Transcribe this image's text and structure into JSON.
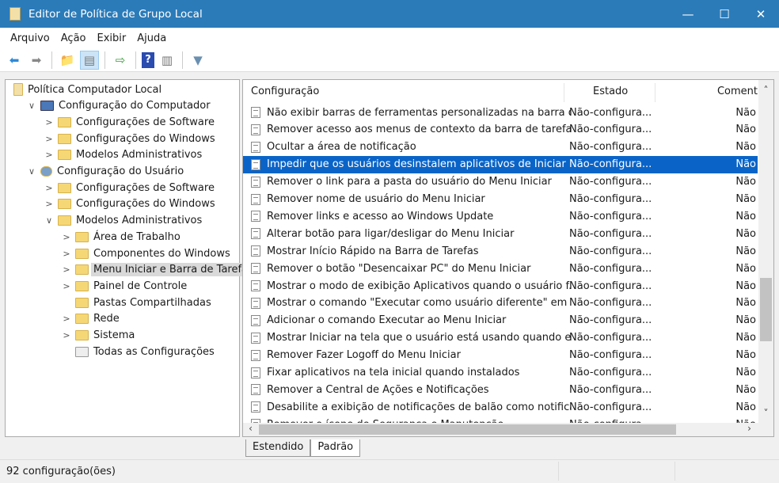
{
  "window": {
    "title": "Editor de Política de Grupo Local",
    "minimize": "—",
    "maximize": "☐",
    "close": "✕"
  },
  "menu": [
    "Arquivo",
    "Ação",
    "Exibir",
    "Ajuda"
  ],
  "tree": [
    {
      "label": "Política Computador Local",
      "level": 0,
      "expander": "",
      "icon": "policy"
    },
    {
      "label": "Configuração do Computador",
      "level": 1,
      "expander": "∨",
      "icon": "computer"
    },
    {
      "label": "Configurações de Software",
      "level": 2,
      "expander": ">",
      "icon": "folder"
    },
    {
      "label": "Configurações do Windows",
      "level": 2,
      "expander": ">",
      "icon": "folder"
    },
    {
      "label": "Modelos Administrativos",
      "level": 2,
      "expander": ">",
      "icon": "folder"
    },
    {
      "label": "Configuração do Usuário",
      "level": 1,
      "expander": "∨",
      "icon": "user"
    },
    {
      "label": "Configurações de Software",
      "level": 2,
      "expander": ">",
      "icon": "folder"
    },
    {
      "label": "Configurações do Windows",
      "level": 2,
      "expander": ">",
      "icon": "folder"
    },
    {
      "label": "Modelos Administrativos",
      "level": 2,
      "expander": "∨",
      "icon": "folder"
    },
    {
      "label": "Área de Trabalho",
      "level": 3,
      "expander": ">",
      "icon": "folder"
    },
    {
      "label": "Componentes do Windows",
      "level": 3,
      "expander": ">",
      "icon": "folder"
    },
    {
      "label": "Menu Iniciar e Barra de Tarefas",
      "level": 3,
      "expander": ">",
      "icon": "folder",
      "selected": true
    },
    {
      "label": "Painel de Controle",
      "level": 3,
      "expander": ">",
      "icon": "folder"
    },
    {
      "label": "Pastas Compartilhadas",
      "level": 3,
      "expander": "",
      "icon": "folder"
    },
    {
      "label": "Rede",
      "level": 3,
      "expander": ">",
      "icon": "folder"
    },
    {
      "label": "Sistema",
      "level": 3,
      "expander": ">",
      "icon": "folder"
    },
    {
      "label": "Todas as Configurações",
      "level": 3,
      "expander": "",
      "icon": "all-settings"
    }
  ],
  "list": {
    "columns": [
      "Configuração",
      "Estado",
      "Coment"
    ],
    "rows": [
      {
        "name": "Não exibir barras de ferramentas personalizadas na barra de ...",
        "state": "Não-configura...",
        "comment": "Não"
      },
      {
        "name": "Remover acesso aos menus de contexto da barra de tarefas",
        "state": "Não-configura...",
        "comment": "Não"
      },
      {
        "name": "Ocultar a área de notificação",
        "state": "Não-configura...",
        "comment": "Não"
      },
      {
        "name": "Impedir que os usuários desinstalem aplicativos de Iniciar",
        "state": "Não-configura...",
        "comment": "Não",
        "selected": true
      },
      {
        "name": "Remover o link para a pasta do usuário do Menu Iniciar",
        "state": "Não-configura...",
        "comment": "Não"
      },
      {
        "name": "Remover nome de usuário do Menu Iniciar",
        "state": "Não-configura...",
        "comment": "Não"
      },
      {
        "name": "Remover links e acesso ao Windows Update",
        "state": "Não-configura...",
        "comment": "Não"
      },
      {
        "name": "Alterar botão para ligar/desligar do Menu Iniciar",
        "state": "Não-configura...",
        "comment": "Não"
      },
      {
        "name": "Mostrar Início Rápido na Barra de Tarefas",
        "state": "Não-configura...",
        "comment": "Não"
      },
      {
        "name": "Remover o botão \"Desencaixar PC\" do Menu Iniciar",
        "state": "Não-configura...",
        "comment": "Não"
      },
      {
        "name": "Mostrar o modo de exibição Aplicativos quando o usuário f...",
        "state": "Não-configura...",
        "comment": "Não"
      },
      {
        "name": "Mostrar o comando \"Executar como usuário diferente\" em I...",
        "state": "Não-configura...",
        "comment": "Não"
      },
      {
        "name": "Adicionar o comando Executar ao Menu Iniciar",
        "state": "Não-configura...",
        "comment": "Não"
      },
      {
        "name": "Mostrar Iniciar na tela que o usuário está usando quando ele...",
        "state": "Não-configura...",
        "comment": "Não"
      },
      {
        "name": "Remover Fazer Logoff do Menu Iniciar",
        "state": "Não-configura...",
        "comment": "Não"
      },
      {
        "name": "Fixar aplicativos na tela inicial quando instalados",
        "state": "Não-configura...",
        "comment": "Não"
      },
      {
        "name": "Remover a Central de Ações e Notificações",
        "state": "Não-configura...",
        "comment": "Não"
      },
      {
        "name": "Desabilite a exibição de notificações de balão como notifica...",
        "state": "Não-configura...",
        "comment": "Não"
      },
      {
        "name": "Remover o ícone de Segurança e Manutenção",
        "state": "Não-configura...",
        "comment": "Não"
      }
    ]
  },
  "tabs": [
    "Estendido",
    "Padrão"
  ],
  "status": "92 configuração(ões)"
}
